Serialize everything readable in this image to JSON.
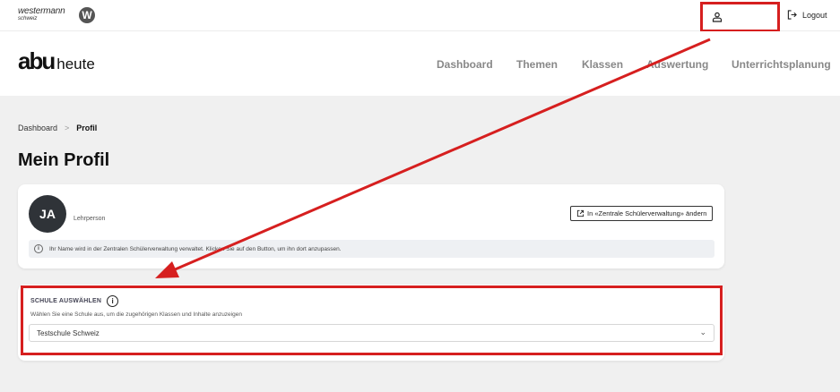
{
  "topbar": {
    "brand_name": "westermann",
    "brand_sub": "schweiz",
    "brand_badge": "W",
    "logout_label": "Logout"
  },
  "header": {
    "logo_main": "abu",
    "logo_sub": "heute",
    "nav": [
      "Dashboard",
      "Themen",
      "Klassen",
      "Auswertung",
      "Unterrichtsplanung"
    ]
  },
  "breadcrumb": {
    "items": [
      "Dashboard",
      "Profil"
    ],
    "separator": ">"
  },
  "page": {
    "title": "Mein Profil"
  },
  "profile": {
    "initials": "JA",
    "role": "Lehrperson",
    "edit_button": "In «Zentrale Schülerverwaltung» ändern",
    "info_text": "Ihr Name wird in der Zentralen Schülerverwaltung verwaltet. Klicken Sie auf den Button, um ihn dort anzupassen."
  },
  "school": {
    "label": "SCHULE AUSWÄHLEN",
    "help": "Wählen Sie eine Schule aus, um die zugehörigen Klassen und Inhalte anzuzeigen",
    "selected": "Testschule Schweiz"
  },
  "colors": {
    "annotation_red": "#d61f1f",
    "avatar_bg": "#2f3338",
    "nav_text": "#888888"
  }
}
